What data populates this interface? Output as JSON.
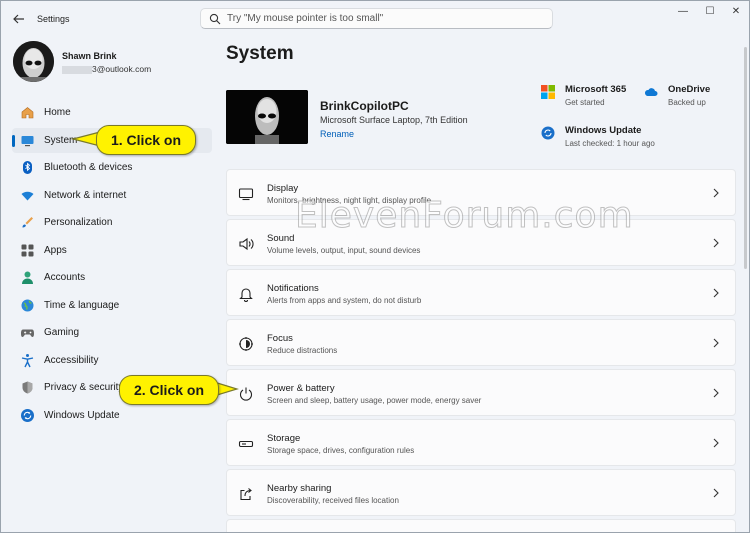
{
  "window": {
    "app_title": "Settings"
  },
  "search": {
    "placeholder": "Try \"My mouse pointer is too small\""
  },
  "window_controls": {
    "minimize": "—",
    "maximize": "☐",
    "close": "✕"
  },
  "user": {
    "name": "Shawn Brink",
    "email_suffix": "3@outlook.com"
  },
  "sidebar": {
    "items": [
      {
        "label": "Home",
        "icon": "home-icon"
      },
      {
        "label": "System",
        "icon": "monitor-icon"
      },
      {
        "label": "Bluetooth & devices",
        "icon": "bluetooth-icon"
      },
      {
        "label": "Network & internet",
        "icon": "wifi-icon"
      },
      {
        "label": "Personalization",
        "icon": "brush-icon"
      },
      {
        "label": "Apps",
        "icon": "apps-icon"
      },
      {
        "label": "Accounts",
        "icon": "person-icon"
      },
      {
        "label": "Time & language",
        "icon": "globe-icon"
      },
      {
        "label": "Gaming",
        "icon": "controller-icon"
      },
      {
        "label": "Accessibility",
        "icon": "accessibility-icon"
      },
      {
        "label": "Privacy & security",
        "icon": "shield-icon"
      },
      {
        "label": "Windows Update",
        "icon": "update-icon"
      }
    ]
  },
  "main": {
    "title": "System",
    "device": {
      "name": "BrinkCopilotPC",
      "model": "Microsoft Surface Laptop, 7th Edition",
      "rename": "Rename"
    },
    "quick": [
      {
        "title": "Microsoft 365",
        "sub": "Get started",
        "icon": "m365-icon"
      },
      {
        "title": "OneDrive",
        "sub": "Backed up",
        "icon": "cloud-icon"
      },
      {
        "title": "Windows Update",
        "sub": "Last checked: 1 hour ago",
        "icon": "update-icon"
      }
    ],
    "cards": [
      {
        "title": "Display",
        "sub": "Monitors, brightness, night light, display profile",
        "icon": "display-icon"
      },
      {
        "title": "Sound",
        "sub": "Volume levels, output, input, sound devices",
        "icon": "speaker-icon"
      },
      {
        "title": "Notifications",
        "sub": "Alerts from apps and system, do not disturb",
        "icon": "bell-icon"
      },
      {
        "title": "Focus",
        "sub": "Reduce distractions",
        "icon": "focus-icon"
      },
      {
        "title": "Power & battery",
        "sub": "Screen and sleep, battery usage, power mode, energy saver",
        "icon": "power-icon"
      },
      {
        "title": "Storage",
        "sub": "Storage space, drives, configuration rules",
        "icon": "storage-icon"
      },
      {
        "title": "Nearby sharing",
        "sub": "Discoverability, received files location",
        "icon": "share-icon"
      }
    ]
  },
  "watermark": "ElevenForum.com",
  "callouts": {
    "one": "1. Click on",
    "two": "2. Click on"
  },
  "colors": {
    "accent": "#0067c0",
    "callout": "#fff200",
    "link": "#005fb8"
  }
}
